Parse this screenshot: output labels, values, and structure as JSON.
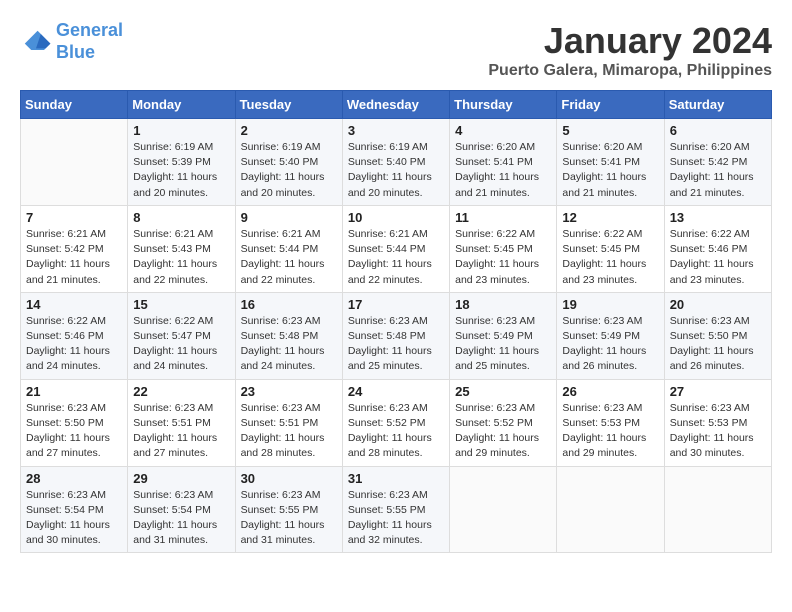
{
  "header": {
    "logo_line1": "General",
    "logo_line2": "Blue",
    "month": "January 2024",
    "location": "Puerto Galera, Mimaropa, Philippines"
  },
  "weekdays": [
    "Sunday",
    "Monday",
    "Tuesday",
    "Wednesday",
    "Thursday",
    "Friday",
    "Saturday"
  ],
  "weeks": [
    [
      {
        "day": "",
        "info": ""
      },
      {
        "day": "1",
        "info": "Sunrise: 6:19 AM\nSunset: 5:39 PM\nDaylight: 11 hours\nand 20 minutes."
      },
      {
        "day": "2",
        "info": "Sunrise: 6:19 AM\nSunset: 5:40 PM\nDaylight: 11 hours\nand 20 minutes."
      },
      {
        "day": "3",
        "info": "Sunrise: 6:19 AM\nSunset: 5:40 PM\nDaylight: 11 hours\nand 20 minutes."
      },
      {
        "day": "4",
        "info": "Sunrise: 6:20 AM\nSunset: 5:41 PM\nDaylight: 11 hours\nand 21 minutes."
      },
      {
        "day": "5",
        "info": "Sunrise: 6:20 AM\nSunset: 5:41 PM\nDaylight: 11 hours\nand 21 minutes."
      },
      {
        "day": "6",
        "info": "Sunrise: 6:20 AM\nSunset: 5:42 PM\nDaylight: 11 hours\nand 21 minutes."
      }
    ],
    [
      {
        "day": "7",
        "info": "Sunrise: 6:21 AM\nSunset: 5:42 PM\nDaylight: 11 hours\nand 21 minutes."
      },
      {
        "day": "8",
        "info": "Sunrise: 6:21 AM\nSunset: 5:43 PM\nDaylight: 11 hours\nand 22 minutes."
      },
      {
        "day": "9",
        "info": "Sunrise: 6:21 AM\nSunset: 5:44 PM\nDaylight: 11 hours\nand 22 minutes."
      },
      {
        "day": "10",
        "info": "Sunrise: 6:21 AM\nSunset: 5:44 PM\nDaylight: 11 hours\nand 22 minutes."
      },
      {
        "day": "11",
        "info": "Sunrise: 6:22 AM\nSunset: 5:45 PM\nDaylight: 11 hours\nand 23 minutes."
      },
      {
        "day": "12",
        "info": "Sunrise: 6:22 AM\nSunset: 5:45 PM\nDaylight: 11 hours\nand 23 minutes."
      },
      {
        "day": "13",
        "info": "Sunrise: 6:22 AM\nSunset: 5:46 PM\nDaylight: 11 hours\nand 23 minutes."
      }
    ],
    [
      {
        "day": "14",
        "info": "Sunrise: 6:22 AM\nSunset: 5:46 PM\nDaylight: 11 hours\nand 24 minutes."
      },
      {
        "day": "15",
        "info": "Sunrise: 6:22 AM\nSunset: 5:47 PM\nDaylight: 11 hours\nand 24 minutes."
      },
      {
        "day": "16",
        "info": "Sunrise: 6:23 AM\nSunset: 5:48 PM\nDaylight: 11 hours\nand 24 minutes."
      },
      {
        "day": "17",
        "info": "Sunrise: 6:23 AM\nSunset: 5:48 PM\nDaylight: 11 hours\nand 25 minutes."
      },
      {
        "day": "18",
        "info": "Sunrise: 6:23 AM\nSunset: 5:49 PM\nDaylight: 11 hours\nand 25 minutes."
      },
      {
        "day": "19",
        "info": "Sunrise: 6:23 AM\nSunset: 5:49 PM\nDaylight: 11 hours\nand 26 minutes."
      },
      {
        "day": "20",
        "info": "Sunrise: 6:23 AM\nSunset: 5:50 PM\nDaylight: 11 hours\nand 26 minutes."
      }
    ],
    [
      {
        "day": "21",
        "info": "Sunrise: 6:23 AM\nSunset: 5:50 PM\nDaylight: 11 hours\nand 27 minutes."
      },
      {
        "day": "22",
        "info": "Sunrise: 6:23 AM\nSunset: 5:51 PM\nDaylight: 11 hours\nand 27 minutes."
      },
      {
        "day": "23",
        "info": "Sunrise: 6:23 AM\nSunset: 5:51 PM\nDaylight: 11 hours\nand 28 minutes."
      },
      {
        "day": "24",
        "info": "Sunrise: 6:23 AM\nSunset: 5:52 PM\nDaylight: 11 hours\nand 28 minutes."
      },
      {
        "day": "25",
        "info": "Sunrise: 6:23 AM\nSunset: 5:52 PM\nDaylight: 11 hours\nand 29 minutes."
      },
      {
        "day": "26",
        "info": "Sunrise: 6:23 AM\nSunset: 5:53 PM\nDaylight: 11 hours\nand 29 minutes."
      },
      {
        "day": "27",
        "info": "Sunrise: 6:23 AM\nSunset: 5:53 PM\nDaylight: 11 hours\nand 30 minutes."
      }
    ],
    [
      {
        "day": "28",
        "info": "Sunrise: 6:23 AM\nSunset: 5:54 PM\nDaylight: 11 hours\nand 30 minutes."
      },
      {
        "day": "29",
        "info": "Sunrise: 6:23 AM\nSunset: 5:54 PM\nDaylight: 11 hours\nand 31 minutes."
      },
      {
        "day": "30",
        "info": "Sunrise: 6:23 AM\nSunset: 5:55 PM\nDaylight: 11 hours\nand 31 minutes."
      },
      {
        "day": "31",
        "info": "Sunrise: 6:23 AM\nSunset: 5:55 PM\nDaylight: 11 hours\nand 32 minutes."
      },
      {
        "day": "",
        "info": ""
      },
      {
        "day": "",
        "info": ""
      },
      {
        "day": "",
        "info": ""
      }
    ]
  ]
}
